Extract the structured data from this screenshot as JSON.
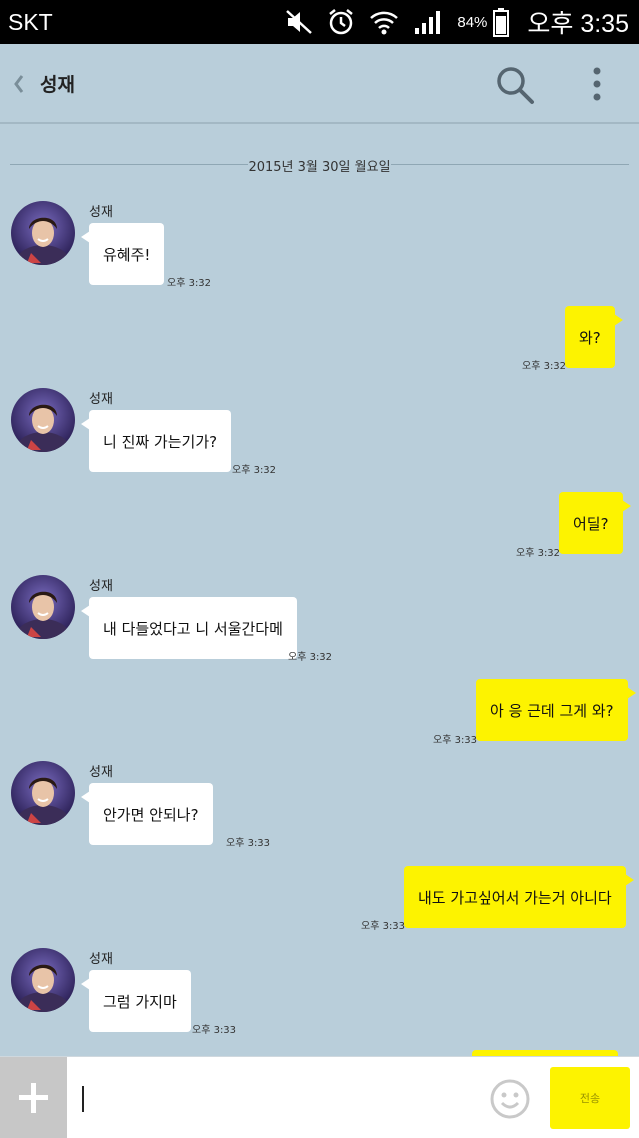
{
  "status_bar": {
    "carrier": "SKT",
    "battery_percent": "84%",
    "time": "오후 3:35"
  },
  "header": {
    "back_icon": "chevron-left-icon",
    "title": "성재",
    "search_icon": "search-icon",
    "menu_icon": "more-vert-icon"
  },
  "chat": {
    "date_separator": "2015년 3월 30일 월요일",
    "messages": [
      {
        "direction": "in",
        "sender": "성재",
        "text": "유혜주!",
        "time": "오후 3:32"
      },
      {
        "direction": "out",
        "text": "와?",
        "time": "오후 3:32"
      },
      {
        "direction": "in",
        "sender": "성재",
        "text": "니 진짜 가는기가?",
        "time": "오후 3:32"
      },
      {
        "direction": "out",
        "text": "어딜?",
        "time": "오후 3:32"
      },
      {
        "direction": "in",
        "sender": "성재",
        "text": "내 다들었다고 니 서울간다메",
        "time": "오후 3:32"
      },
      {
        "direction": "out",
        "text": "아 응 근데 그게 와?",
        "time": "오후 3:33"
      },
      {
        "direction": "in",
        "sender": "성재",
        "text": "안가면  안되나?",
        "time": "오후 3:33"
      },
      {
        "direction": "out",
        "text": "내도 가고싶어서 가는거 아니다",
        "time": "오후 3:33"
      },
      {
        "direction": "in",
        "sender": "성재",
        "text": "그럼 가지마",
        "time": "오후 3:33"
      }
    ]
  },
  "input_bar": {
    "plus_icon": "plus-icon",
    "input_value": "",
    "emoji_icon": "emoji-icon",
    "send_label": "전송"
  },
  "colors": {
    "background": "#b9ceda",
    "outgoing_bubble": "#fdf300",
    "incoming_bubble": "#ffffff"
  }
}
